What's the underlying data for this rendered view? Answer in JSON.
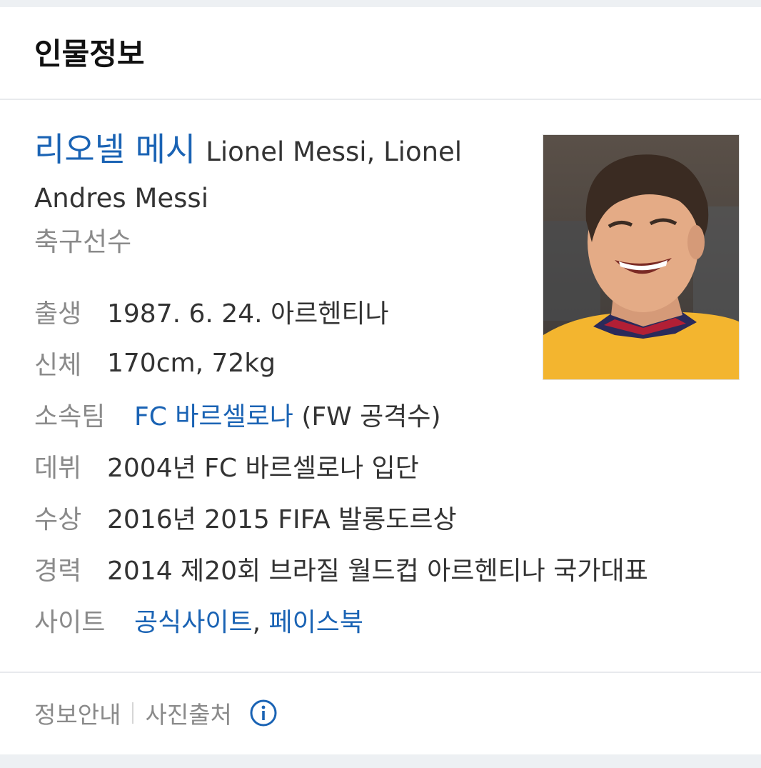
{
  "header": {
    "title": "인물정보"
  },
  "profile": {
    "name_ko": "리오넬 메시",
    "name_en": "Lionel Messi, Lionel Andres Messi",
    "occupation": "축구선수",
    "photo_icon": "person-photo"
  },
  "info": {
    "birth": {
      "label": "출생",
      "value": "1987. 6. 24. 아르헨티나"
    },
    "body": {
      "label": "신체",
      "value": "170cm, 72kg"
    },
    "team": {
      "label": "소속팀",
      "link": "FC 바르셀로나",
      "suffix": " (FW 공격수)"
    },
    "debut": {
      "label": "데뷔",
      "value": "2004년 FC 바르셀로나 입단"
    },
    "award": {
      "label": "수상",
      "value": "2016년 2015 FIFA 발롱도르상"
    },
    "career": {
      "label": "경력",
      "value": "2014 제20회 브라질 월드컵 아르헨티나 국가대표"
    },
    "site": {
      "label": "사이트",
      "link1": "공식사이트",
      "separator": ", ",
      "link2": "페이스북"
    }
  },
  "footer": {
    "info_guide": "정보안내",
    "photo_source": "사진출처",
    "info_icon": "info-circle-icon"
  },
  "colors": {
    "link": "#1a63b4",
    "label": "#8a8a8a",
    "text": "#333333",
    "jersey": "#f3b52f"
  }
}
